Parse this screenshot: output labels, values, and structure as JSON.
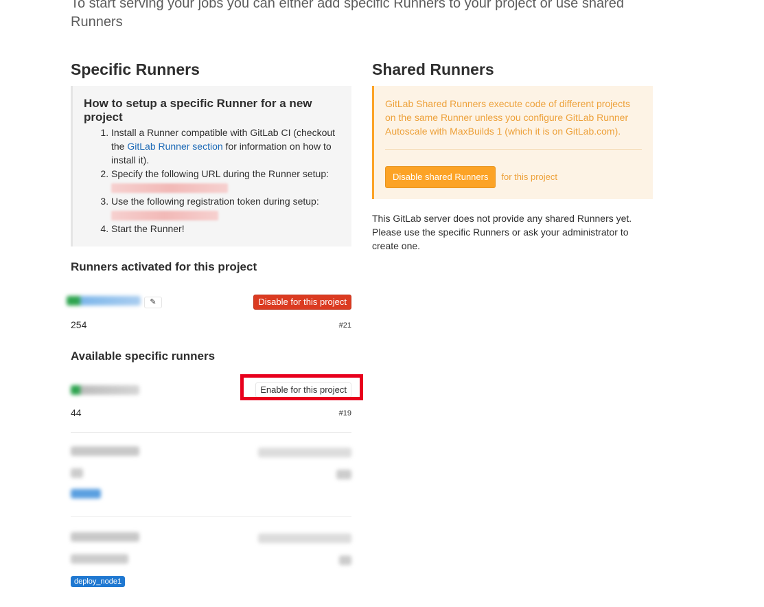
{
  "intro": "To start serving your jobs you can either add specific Runners to your project or use shared Runners",
  "specific": {
    "title": "Specific Runners",
    "howto_title": "How to setup a specific Runner for a new project",
    "step1_a": "Install a Runner compatible with GitLab CI (checkout the ",
    "step1_link": "GitLab Runner section",
    "step1_b": " for information on how to install it).",
    "step2": "Specify the following URL during the Runner setup:",
    "step3": "Use the following registration token during setup:",
    "step4": "Start the Runner!",
    "activated_title": "Runners activated for this project",
    "disable_btn": "Disable for this project",
    "activated_id": "254",
    "activated_num": "#21",
    "available_title": "Available specific runners",
    "enable_btn": "Enable for this project",
    "avail1_id": "44",
    "avail1_num": "#19",
    "tag_deploy": "deploy_node1"
  },
  "shared": {
    "title": "Shared Runners",
    "info": "GitLab Shared Runners execute code of different projects on the same Runner unless you configure GitLab Runner Autoscale with MaxBuilds 1 (which it is on GitLab.com).",
    "disable_btn": "Disable shared Runners",
    "for_project": "for this project",
    "note": "This GitLab server does not provide any shared Runners yet. Please use the specific Runners or ask your administrator to create one."
  },
  "colors": {
    "accent_red": "#db3b21",
    "accent_orange": "#fca326",
    "link_blue": "#1b69b6",
    "highlight_red": "#e8001c"
  },
  "icons": {
    "edit": "edit-icon"
  }
}
